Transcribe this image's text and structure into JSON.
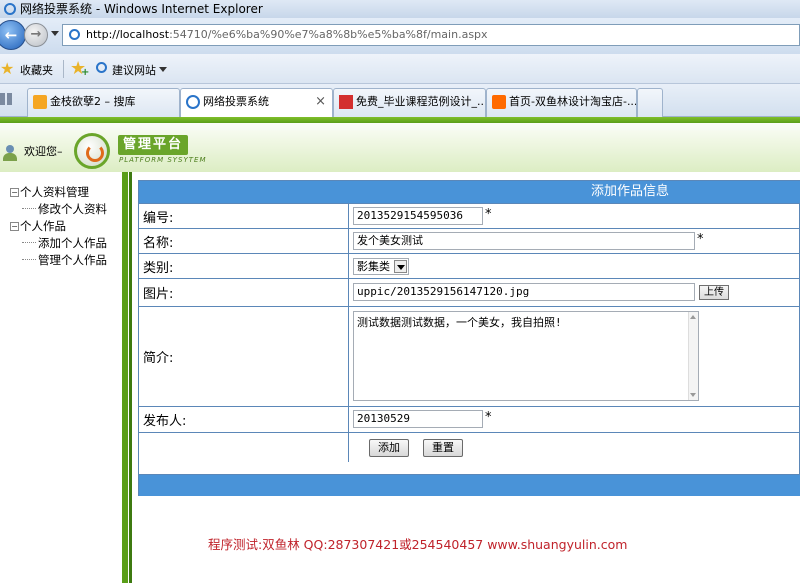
{
  "window": {
    "title": "网络投票系统 - Windows Internet Explorer"
  },
  "address_bar": {
    "url_host": "http://localhost",
    "url_rest": ":54710/%e6%ba%90%e7%a8%8b%e5%ba%8f/main.aspx"
  },
  "favorites_bar": {
    "favorites_label": "收藏夹",
    "suggested_label": "建议网站"
  },
  "tabs": [
    {
      "label": "金枝欲孽2 – 搜库",
      "icon": "soku-icon"
    },
    {
      "label": "网络投票系统",
      "icon": "ie-page-icon",
      "active": true,
      "close": "×"
    },
    {
      "label": "免费_毕业课程范例设计_...",
      "icon": "red-site-icon"
    },
    {
      "label": "首页-双鱼林设计淘宝店-...",
      "icon": "taobao-icon"
    }
  ],
  "header": {
    "welcome": "欢迎您–",
    "logo_title": "管理平台",
    "logo_subtitle": "PLATFORM SYSYTEM"
  },
  "sidebar": {
    "groups": [
      {
        "toggle": "−",
        "label": "个人资料管理",
        "children": [
          "修改个人资料"
        ]
      },
      {
        "toggle": "−",
        "label": "个人作品",
        "children": [
          "添加个人作品",
          "管理个人作品"
        ]
      }
    ]
  },
  "form": {
    "title": "添加作品信息",
    "required_mark": "*",
    "fields": {
      "id": {
        "label": "编号:",
        "value": "2013529154595036"
      },
      "name": {
        "label": "名称:",
        "value": "发个美女测试"
      },
      "category": {
        "label": "类别:",
        "value": "影集类"
      },
      "image": {
        "label": "图片:",
        "value": "uppic/2013529156147120.jpg",
        "upload_label": "上传"
      },
      "intro": {
        "label": "简介:",
        "value": "测试数据测试数据，一个美女，我自拍照!"
      },
      "publisher": {
        "label": "发布人:",
        "value": "20130529"
      }
    },
    "buttons": {
      "add": "添加",
      "reset": "重置"
    }
  },
  "footer_credit": "程序测试:双鱼林 QQ:287307421或254540457 www.shuangyulin.com",
  "colors": {
    "accent_blue": "#4993d8",
    "brand_green": "#5a9e18",
    "credit_red": "#c0232b"
  }
}
